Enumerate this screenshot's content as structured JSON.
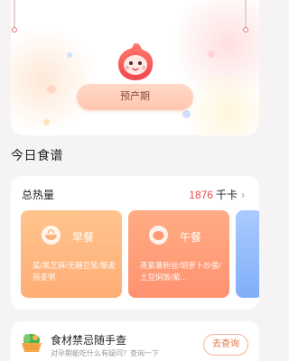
{
  "hero": {
    "stage_label": "预产期"
  },
  "section": {
    "title": "今日食谱"
  },
  "calories": {
    "label": "总热量",
    "value": "1876",
    "unit": "千卡",
    "chevron_icon": "chevron-right-icon"
  },
  "meals": [
    {
      "name": "早餐",
      "icon": "bowl-icon",
      "description": "菜/黑芝麻/无糖豆浆/藜麦燕麦粥"
    },
    {
      "name": "午餐",
      "icon": "rice-bowl-icon",
      "description": "蒸紫薯粉丝/胡萝卜炒蛋/土豆焖饭/紫..."
    }
  ],
  "lookup": {
    "title": "食材禁忌随手查",
    "subtitle": "对孕期能吃什么有疑问？查询一下",
    "button": "去查询",
    "icon": "food-basket-icon"
  },
  "colors": {
    "accent_red": "#f04c55",
    "calorie_red": "#e94a4a",
    "breakfast": "#ffb47c",
    "lunch": "#ff9c78",
    "dinner": "#8fb6fa"
  }
}
